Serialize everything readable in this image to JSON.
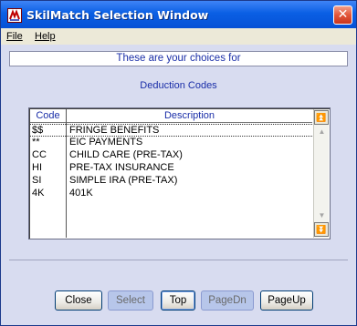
{
  "window": {
    "title": "SkilMatch Selection Window",
    "close_glyph": "✕"
  },
  "menu": {
    "items": [
      {
        "label": "File"
      },
      {
        "label": "Help"
      }
    ]
  },
  "header": {
    "text": "These are your choices for"
  },
  "subtitle": "Deduction Codes",
  "table": {
    "columns": [
      "Code",
      "Description"
    ],
    "rows": [
      {
        "code": "$$",
        "description": "FRINGE BENEFITS"
      },
      {
        "code": "**",
        "description": "EIC PAYMENTS"
      },
      {
        "code": "CC",
        "description": "CHILD CARE (PRE-TAX)"
      },
      {
        "code": "HI",
        "description": "PRE-TAX INSURANCE"
      },
      {
        "code": "SI",
        "description": "SIMPLE IRA (PRE-TAX)"
      },
      {
        "code": "4K",
        "description": "401K"
      }
    ]
  },
  "scrollbar": {
    "top_glyph": "⏫",
    "up_glyph": "▲",
    "down_glyph": "▼",
    "bottom_glyph": "⏬"
  },
  "buttons": {
    "close": "Close",
    "select": "Select",
    "top": "Top",
    "pagedn": "PageDn",
    "pageup": "PageUp"
  },
  "colors": {
    "title_bar": "#0a5fe4",
    "window_bg": "#d8dcf0",
    "label_blue": "#1a2ea8"
  }
}
